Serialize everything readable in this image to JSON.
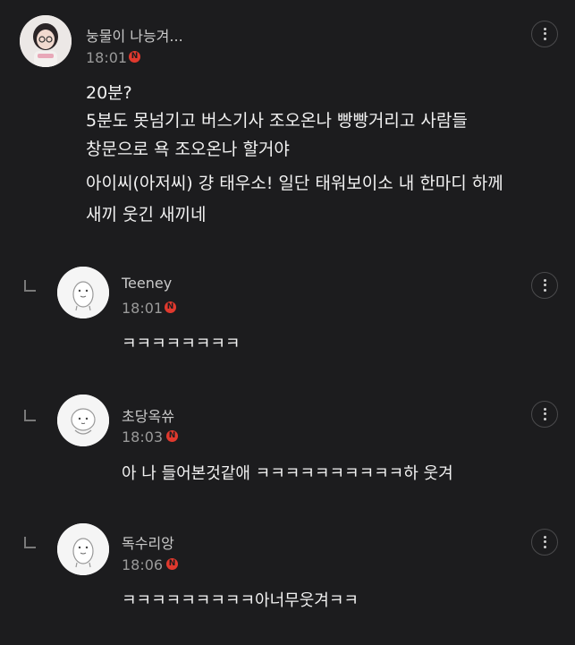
{
  "post": {
    "author": "눙물이 나능겨...",
    "time": "18:01",
    "badge": "N",
    "lines": [
      "20분?",
      "5분도 못넘기고 버스기사 조오온나 빵빵거리고 사람들",
      "창문으로 욕 조오온나 할거야",
      "아이씨(아저씨) 걍 태우소! 일단 태워보이소 내 한마디 하께",
      "새끼 웃긴 새끼네"
    ]
  },
  "replies": [
    {
      "author": "Teeney",
      "time": "18:01",
      "badge": "N",
      "text": "ㅋㅋㅋㅋㅋㅋㅋㅋ"
    },
    {
      "author": "초당옥쓔",
      "time": "18:03",
      "badge": "N",
      "text": "아 나 들어본것같애 ㅋㅋㅋㅋㅋㅋㅋㅋㅋㅋ하 웃겨"
    },
    {
      "author": "독수리앙",
      "time": "18:06",
      "badge": "N",
      "text": "ㅋㅋㅋㅋㅋㅋㅋㅋㅋ아너무웃겨ㅋㅋ"
    }
  ],
  "icons": {
    "more": "more-vertical-icon",
    "reply": "reply-arrow-icon",
    "new": "new-badge"
  },
  "colors": {
    "background": "#1c1c1e",
    "badge": "#e0392e"
  }
}
